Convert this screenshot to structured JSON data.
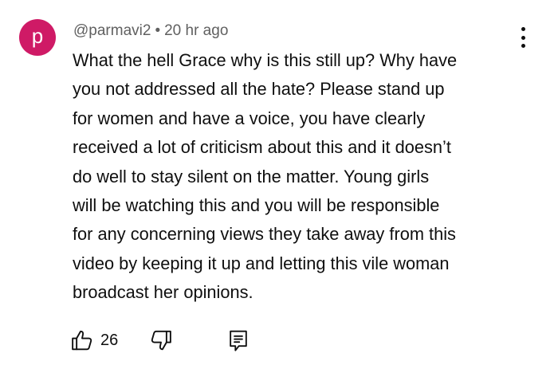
{
  "comment": {
    "avatar_letter": "p",
    "avatar_color": "#cf1a66",
    "author": "@parmavi2",
    "separator": "•",
    "time": "20 hr ago",
    "lines": [
      "What the hell Grace why is this still up? Why have",
      "you not addressed all the hate? Please stand up",
      "for women and have a voice, you have clearly",
      "received a lot of criticism about this and it doesn’t",
      "do well to stay silent on the matter. Young girls",
      "will be watching this and you will be responsible",
      "for any concerning views they take away from this",
      "video by keeping it up and letting this vile woman",
      "broadcast her opinions."
    ],
    "like_count": "26"
  },
  "icons": {
    "menu": "more-vert-icon",
    "like": "thumbs-up-icon",
    "dislike": "thumbs-down-icon",
    "reply": "reply-comment-icon"
  }
}
